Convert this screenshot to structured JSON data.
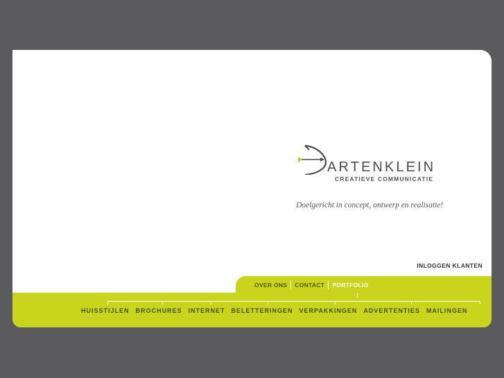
{
  "brand": {
    "name_prefix": "",
    "name_highlight_char": "",
    "name_rest": "ARTENKLEIN",
    "subtitle": "CREATIEVE COMMUNICATIE",
    "tagline": "Doelgericht in concept, ontwerp en realisatie!"
  },
  "login_link": "INLOGGEN KLANTEN",
  "top_nav": [
    {
      "label": "OVER ONS"
    },
    {
      "label": "CONTACT"
    },
    {
      "label": "PORTFOLIO"
    }
  ],
  "categories": [
    {
      "label": "HUISSTIJLEN"
    },
    {
      "label": "BROCHURES"
    },
    {
      "label": "INTERNET"
    },
    {
      "label": "BELETTERINGEN"
    },
    {
      "label": "VERPAKKINGEN"
    },
    {
      "label": "ADVERTENTIES"
    },
    {
      "label": "MAILINGEN"
    }
  ],
  "colors": {
    "background": "#5b5b5d",
    "accent": "#c9d41c",
    "text_dark": "#4c4c4c"
  },
  "active_nav": "PORTFOLIO"
}
